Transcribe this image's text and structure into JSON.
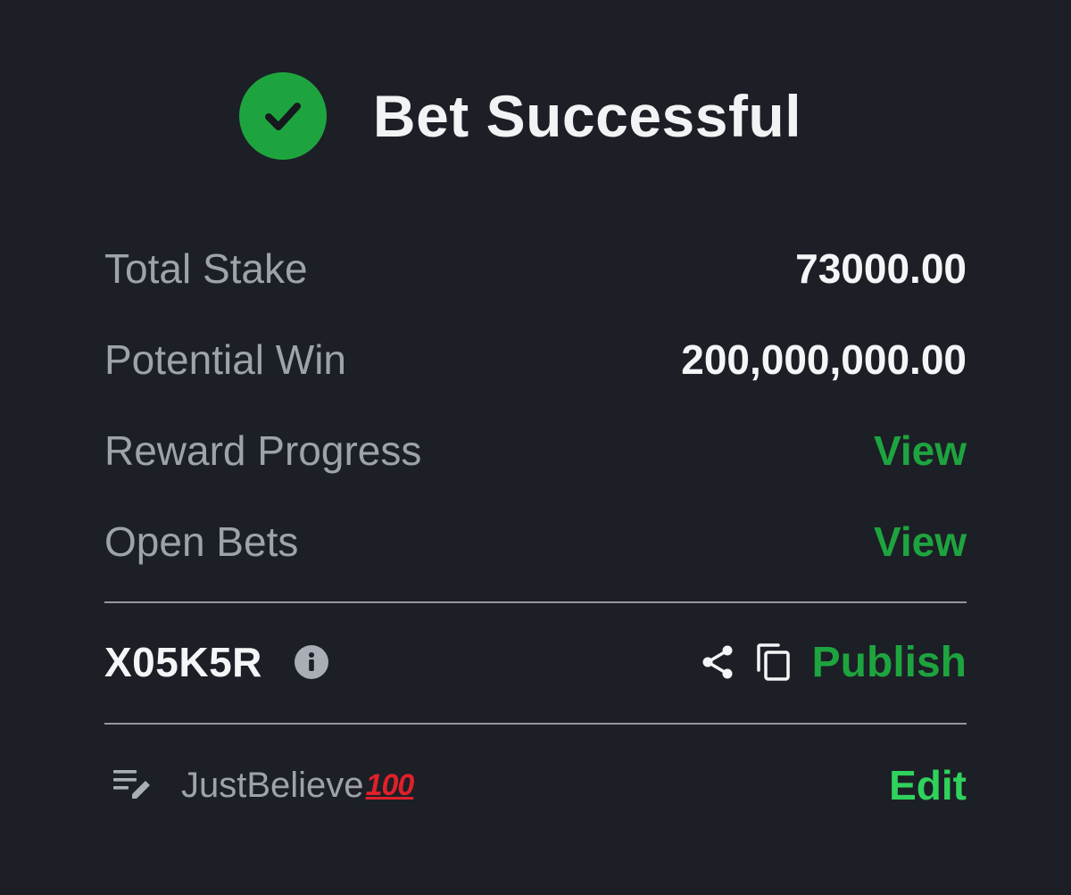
{
  "header": {
    "title": "Bet Successful",
    "status_icon": "check-circle-icon",
    "accent_color": "#1ea43f"
  },
  "summary": {
    "rows": [
      {
        "label": "Total Stake",
        "value": "73000.00"
      },
      {
        "label": "Potential Win",
        "value": "200,000,000.00"
      },
      {
        "label": "Reward Progress",
        "link": "View"
      },
      {
        "label": "Open Bets",
        "link": "View"
      }
    ]
  },
  "booking": {
    "code": "X05K5R",
    "info_icon": "info-icon",
    "share_icon": "share-icon",
    "copy_icon": "copy-icon",
    "publish_label": "Publish"
  },
  "note": {
    "icon": "note-edit-icon",
    "text": "JustBelieve",
    "emoji": "100",
    "edit_label": "Edit",
    "edit_color": "#2fd35c"
  }
}
